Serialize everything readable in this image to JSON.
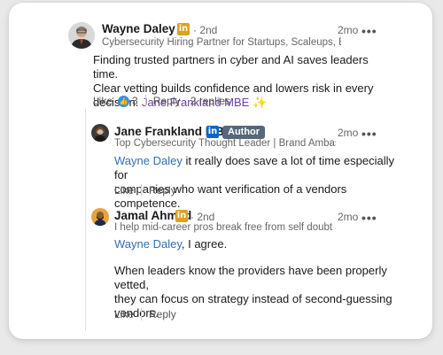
{
  "comments": [
    {
      "name": "Wayne Daley",
      "degree": "· 2nd",
      "headline": "Cybersecurity Hiring Partner for Startups, Scaleups, Enterpris...",
      "time": "2mo",
      "body_lines": [
        "Finding trusted partners in cyber and AI saves leaders time.",
        "Clear vetting builds confidence and lowers risk in every",
        "decision."
      ],
      "mention": "Jane Frankland MBE",
      "sparkle": "✨",
      "like_label": "Like",
      "like_count": "3",
      "reply_label": "Reply",
      "replies_label": "· 2 replies"
    },
    {
      "name": "Jane Frankland MBE",
      "author_badge": "Author",
      "headline": "Top Cybersecurity Thought Leader | Brand Ambassador...",
      "time": "2mo",
      "mention": "Wayne Daley",
      "body_rest": " it really does save a lot of time especially for",
      "body_line2": "companies who want verification of a vendors competence.",
      "like_label": "Like",
      "reply_label": "Reply"
    },
    {
      "name": "Jamal Ahmed",
      "degree": "· 2nd",
      "headline": "I help mid-career pros break free from self doubt and b...",
      "time": "2mo",
      "mention": "Wayne Daley",
      "body_rest": ", I agree.",
      "para2_lines": [
        "When leaders know the providers have been properly vetted,",
        "they can focus on strategy instead of second-guessing",
        "vendors."
      ],
      "like_label": "Like",
      "reply_label": "Reply"
    }
  ],
  "icons": {
    "linkedin": "in",
    "more": "•••",
    "like": "thumbs-up"
  },
  "colors": {
    "mention": "#2f6fb0",
    "mention_purple": "#6b3fa0",
    "linkedin_gold": "#d9a21f",
    "linkedin_blue": "#0a66c2",
    "author_badge": "#56687a"
  }
}
